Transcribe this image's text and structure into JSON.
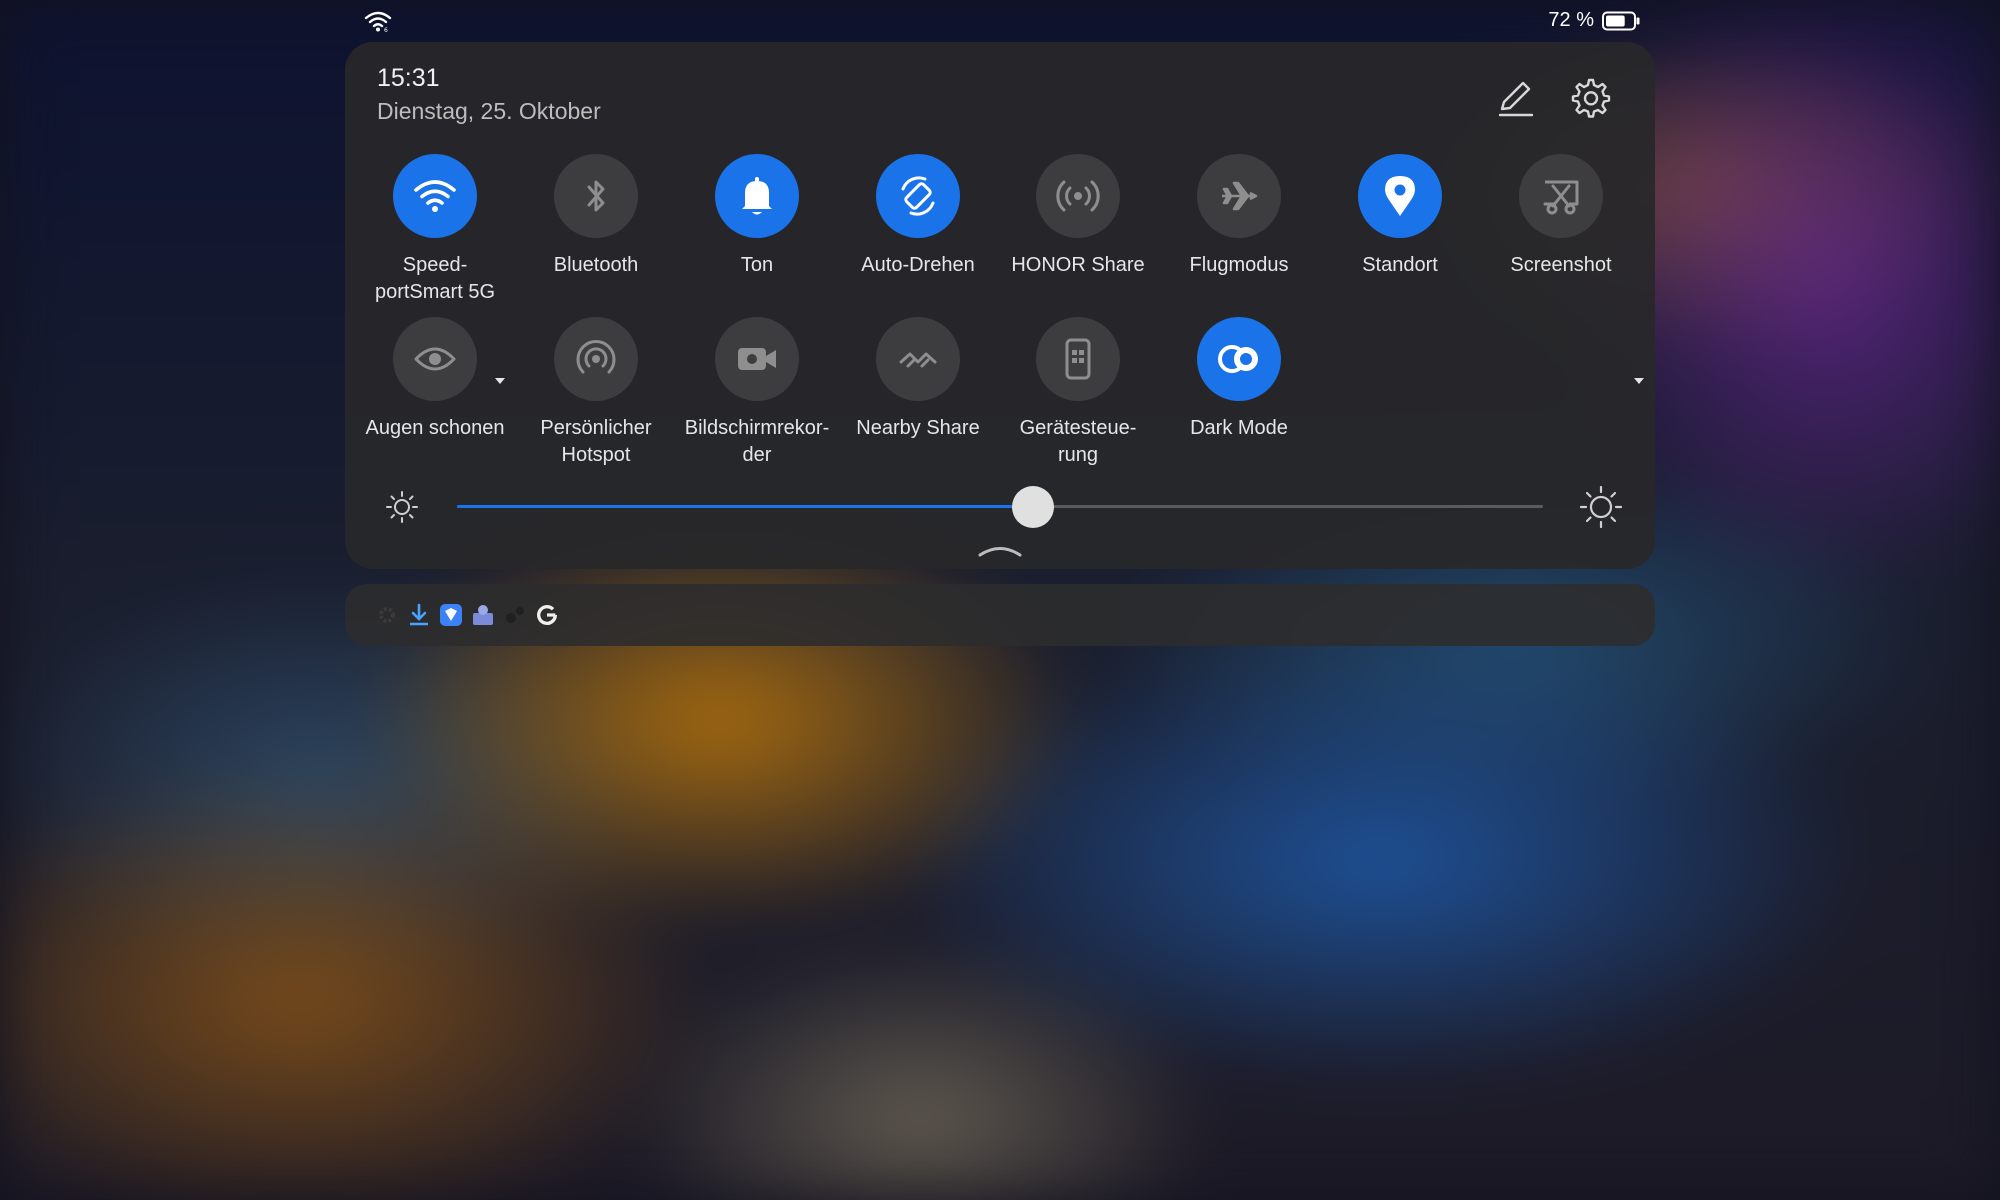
{
  "status_bar": {
    "battery_text": "72 %",
    "battery_level": 0.72
  },
  "header": {
    "time": "15:31",
    "date": "Dienstag, 25. Oktober",
    "edit_icon": "pencil-icon",
    "settings_icon": "gear-icon"
  },
  "tiles": [
    {
      "label": "Speed-\nportSmart 5G",
      "icon": "wifi-icon",
      "on": true,
      "dropdown": true
    },
    {
      "label": "Bluetooth",
      "icon": "bluetooth-icon",
      "on": false
    },
    {
      "label": "Ton",
      "icon": "bell-icon",
      "on": true
    },
    {
      "label": "Auto-Drehen",
      "icon": "auto-rotate-icon",
      "on": true
    },
    {
      "label": "HONOR Share",
      "icon": "honor-share-icon",
      "on": false
    },
    {
      "label": "Flugmodus",
      "icon": "airplane-icon",
      "on": false
    },
    {
      "label": "Standort",
      "icon": "location-pin-icon",
      "on": true
    },
    {
      "label": "Screenshot",
      "icon": "screenshot-scissors-icon",
      "on": false,
      "dropdown": true
    },
    {
      "label": "Augen schonen",
      "icon": "eye-icon",
      "on": false
    },
    {
      "label": "Persönlicher\nHotspot",
      "icon": "hotspot-icon",
      "on": false
    },
    {
      "label": "Bildschirmrekor-\nder",
      "icon": "screen-record-icon",
      "on": false
    },
    {
      "label": "Nearby Share",
      "icon": "nearby-share-icon",
      "on": false
    },
    {
      "label": "Gerätesteue-\nrung",
      "icon": "device-control-icon",
      "on": false
    },
    {
      "label": "Dark Mode",
      "icon": "dark-mode-icon",
      "on": true
    }
  ],
  "brightness": {
    "level": 0.53
  },
  "notification_icons": [
    "settings-gear-icon",
    "download-icon",
    "shield-app-icon",
    "vpn-app-icon",
    "gears-icon",
    "google-icon"
  ],
  "colors": {
    "accent": "#1a73e8",
    "tile_off": "#3d3d3f",
    "panel": "#28282a"
  }
}
